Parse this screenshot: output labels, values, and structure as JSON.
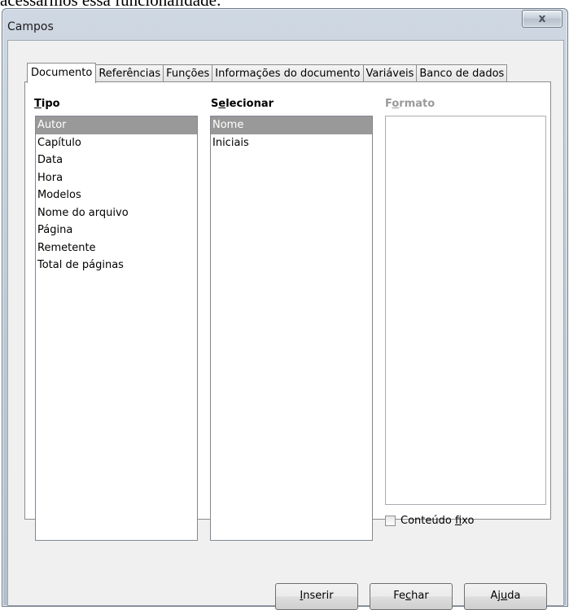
{
  "background": {
    "caption": "acessarmos essa funcionalidade:"
  },
  "window": {
    "title": "Campos",
    "close_glyph": "x"
  },
  "tabs": [
    {
      "label": "Documento",
      "active": true
    },
    {
      "label": "Referências",
      "active": false
    },
    {
      "label": "Funções",
      "active": false
    },
    {
      "label": "Informações do documento",
      "active": false
    },
    {
      "label": "Variáveis",
      "active": false
    },
    {
      "label": "Banco de dados",
      "active": false
    }
  ],
  "tipo": {
    "label": "Tipo",
    "items": [
      "Autor",
      "Capítulo",
      "Data",
      "Hora",
      "Modelos",
      "Nome do arquivo",
      "Página",
      "Remetente",
      "Total de páginas"
    ],
    "selected": "Autor"
  },
  "selecionar": {
    "label": "Selecionar",
    "items": [
      "Nome",
      "Iniciais"
    ],
    "selected": "Nome"
  },
  "formato": {
    "label": "Formato",
    "enabled": false,
    "items": []
  },
  "fixed_content": {
    "label": "Conteúdo fixo",
    "checked": false
  },
  "buttons": {
    "insert": "Inserir",
    "close": "Fechar",
    "help": "Ajuda"
  },
  "colors": {
    "selection": "#999999",
    "disabled_text": "#9a9a9a",
    "dialog_bg": "#f0f0f0"
  }
}
